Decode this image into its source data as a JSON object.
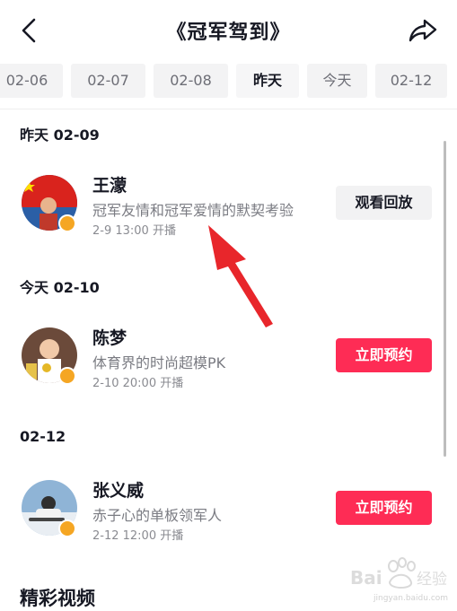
{
  "header": {
    "title": "《冠军驾到》",
    "back_icon": "back-arrow-icon",
    "share_icon": "share-icon"
  },
  "date_tabs": [
    {
      "label": "02-06",
      "active": false
    },
    {
      "label": "02-07",
      "active": false
    },
    {
      "label": "02-08",
      "active": false
    },
    {
      "label": "昨天",
      "active": true
    },
    {
      "label": "今天",
      "active": false
    },
    {
      "label": "02-12",
      "active": false
    }
  ],
  "sections": [
    {
      "label": "昨天 02-09",
      "item": {
        "name": "王濛",
        "desc": "冠军友情和冠军爱情的默契考验",
        "time": "2-9 13:00 开播",
        "button": "观看回放"
      }
    },
    {
      "label": "今天 02-10",
      "item": {
        "name": "陈梦",
        "desc": "体育界的时尚超模PK",
        "time": "2-10 20:00 开播",
        "button": "立即预约"
      }
    },
    {
      "label": "02-12",
      "item": {
        "name": "张义威",
        "desc": "赤子心的单板领军人",
        "time": "2-12 12:00 开播",
        "button": "立即预约"
      }
    }
  ],
  "featured_title": "精彩视频",
  "colors": {
    "accent_red": "#fe2c55",
    "verify_orange": "#f5a623",
    "annotation_arrow": "#e8262b"
  },
  "watermark": {
    "brand": "Bai度经验",
    "url": "jingyan.baidu.com"
  }
}
